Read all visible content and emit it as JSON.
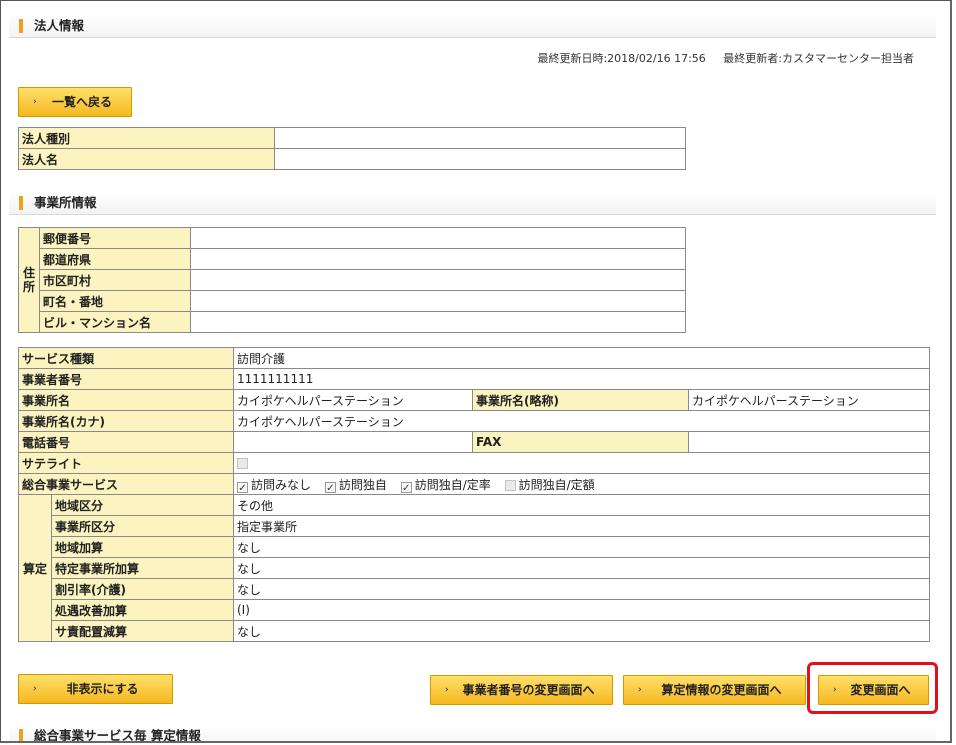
{
  "corp_section": {
    "title": "法人情報",
    "last_updated_label": "最終更新日時:",
    "last_updated_value": "2018/02/16 17:56",
    "last_updater_label": "最終更新者:",
    "last_updater_value": "カスタマーセンター担当者",
    "back_button": "一覧へ戻る",
    "rows": [
      {
        "label": "法人種別",
        "value": ""
      },
      {
        "label": "法人名",
        "value": ""
      }
    ]
  },
  "office_section": {
    "title": "事業所情報",
    "address_group": "住所",
    "address_rows": [
      {
        "label": "郵便番号",
        "value": ""
      },
      {
        "label": "都道府県",
        "value": ""
      },
      {
        "label": "市区町村",
        "value": ""
      },
      {
        "label": "町名・番地",
        "value": ""
      },
      {
        "label": "ビル・マンション名",
        "value": ""
      }
    ],
    "service_type_label": "サービス種類",
    "service_type_value": "訪問介護",
    "business_number_label": "事業者番号",
    "business_number_value": "1111111111",
    "office_name_label": "事業所名",
    "office_name_value": "カイポケヘルパーステーション",
    "office_short_label": "事業所名(略称)",
    "office_short_value": "カイポケヘルパーステーション",
    "office_kana_label": "事業所名(カナ)",
    "office_kana_value": "カイポケヘルパーステーション",
    "phone_label": "電話番号",
    "phone_value": "",
    "fax_label": "FAX",
    "fax_value": "",
    "satellite_label": "サテライト",
    "general_service_label": "総合事業サービス",
    "general_service_options": [
      {
        "label": "訪問みなし",
        "checked": true
      },
      {
        "label": "訪問独自",
        "checked": true
      },
      {
        "label": "訪問独自/定率",
        "checked": true
      },
      {
        "label": "訪問独自/定額",
        "checked": false
      }
    ],
    "calc_group": "算定",
    "calc_rows": [
      {
        "label": "地域区分",
        "value": "その他"
      },
      {
        "label": "事業所区分",
        "value": "指定事業所"
      },
      {
        "label": "地域加算",
        "value": "なし"
      },
      {
        "label": "特定事業所加算",
        "value": "なし"
      },
      {
        "label": "割引率(介護)",
        "value": "なし"
      },
      {
        "label": "処遇改善加算",
        "value": "(Ⅰ)"
      },
      {
        "label": "サ責配置減算",
        "value": "なし"
      }
    ]
  },
  "buttons": {
    "hide": "非表示にする",
    "change_business_number": "事業者番号の変更画面へ",
    "change_calc_info": "算定情報の変更画面へ",
    "change_screen": "変更画面へ"
  },
  "next_section": {
    "title": "総合事業サービス毎 算定情報"
  },
  "colors": {
    "label_bg": "#fbf4c0",
    "button": "#f4b820",
    "highlight": "#e3101a",
    "section_bar": "#f0a020"
  }
}
